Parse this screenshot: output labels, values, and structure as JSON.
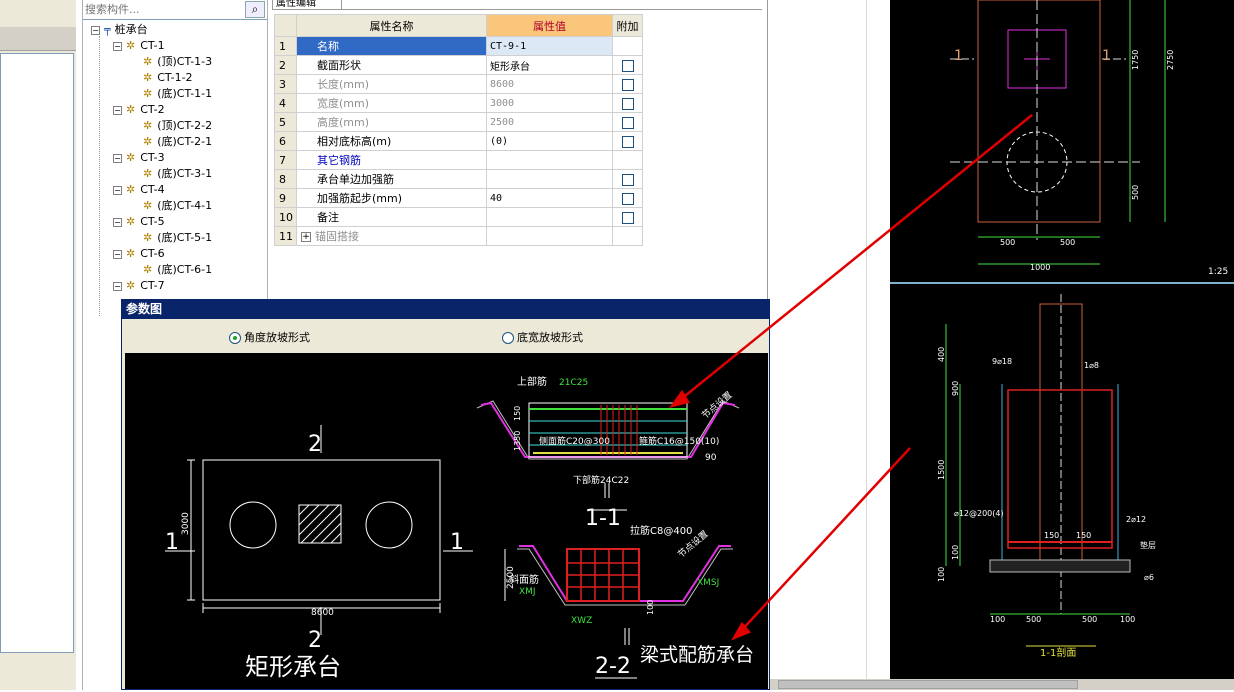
{
  "search": {
    "placeholder": "搜索构件..."
  },
  "tree": {
    "root": "桩承台",
    "nodes": [
      {
        "label": "CT-1",
        "level": 1
      },
      {
        "label": "(顶)CT-1-3",
        "level": 2
      },
      {
        "label": "CT-1-2",
        "level": 2
      },
      {
        "label": "(底)CT-1-1",
        "level": 2
      },
      {
        "label": "CT-2",
        "level": 1
      },
      {
        "label": "(顶)CT-2-2",
        "level": 2
      },
      {
        "label": "(底)CT-2-1",
        "level": 2
      },
      {
        "label": "CT-3",
        "level": 1
      },
      {
        "label": "(底)CT-3-1",
        "level": 2
      },
      {
        "label": "CT-4",
        "level": 1
      },
      {
        "label": "(底)CT-4-1",
        "level": 2
      },
      {
        "label": "CT-5",
        "level": 1
      },
      {
        "label": "(底)CT-5-1",
        "level": 2
      },
      {
        "label": "CT-6",
        "level": 1
      },
      {
        "label": "(底)CT-6-1",
        "level": 2
      },
      {
        "label": "CT-7",
        "level": 1
      }
    ]
  },
  "properties": {
    "tab": "属性编辑",
    "headers": {
      "name": "属性名称",
      "value": "属性值",
      "extra": "附加"
    },
    "rows": [
      {
        "num": "1",
        "name": "名称",
        "value": "CT-9-1",
        "style": "selected",
        "check": false
      },
      {
        "num": "2",
        "name": "截面形状",
        "value": "矩形承台",
        "style": "normal",
        "check": true
      },
      {
        "num": "3",
        "name": "长度(mm)",
        "value": "8600",
        "style": "gray",
        "check": true
      },
      {
        "num": "4",
        "name": "宽度(mm)",
        "value": "3000",
        "style": "gray",
        "check": true
      },
      {
        "num": "5",
        "name": "高度(mm)",
        "value": "2500",
        "style": "gray",
        "check": true
      },
      {
        "num": "6",
        "name": "相对底标高(m)",
        "value": "(0)",
        "style": "normal",
        "check": true
      },
      {
        "num": "7",
        "name": "其它钢筋",
        "value": "",
        "style": "blue",
        "check": false
      },
      {
        "num": "8",
        "name": "承台单边加强筋",
        "value": "",
        "style": "normal",
        "check": true
      },
      {
        "num": "9",
        "name": "加强筋起步(mm)",
        "value": "40",
        "style": "normal",
        "check": true
      },
      {
        "num": "10",
        "name": "备注",
        "value": "",
        "style": "normal",
        "check": true
      },
      {
        "num": "11",
        "name": "锚固搭接",
        "value": "",
        "style": "expand",
        "check": false
      }
    ]
  },
  "param_dialog": {
    "title": "参数图",
    "radio_angle": "角度放坡形式",
    "radio_width": "底宽放坡形式",
    "plan": {
      "label_top": "2",
      "label_bottom": "2",
      "label_left": "1",
      "label_right": "1",
      "dim_width": "8600",
      "dim_height": "3000",
      "caption": "矩形承台"
    },
    "section11": {
      "top_bar": "上部筋",
      "top_bar_val": "21C25",
      "side_bar": "侧面筋C20@300",
      "stirrup": "箍筋C16@150(10)",
      "bottom_bar": "下部筋24C22",
      "slope": "90",
      "dim1": "150",
      "dim2": "1350",
      "note": "节点设置",
      "caption": "1-1"
    },
    "section22": {
      "tie_bar": "拉筋C8@400",
      "slope_bar": "斜面筋",
      "xmj": "XMJ",
      "xmsj": "XMSJ",
      "xwz": "XWZ",
      "dim1": "2500",
      "dim2": "100",
      "note": "节点设置",
      "caption": "2-2"
    },
    "right_caption": "梁式配筋承台"
  },
  "cad": {
    "top": {
      "label_left": "1",
      "label_right": "1",
      "dim_a": "1750",
      "dim_b": "2750",
      "dim_c": "500",
      "dim_d": "500",
      "dim_e": "500",
      "dim_total": "1000",
      "scale": "1:25"
    },
    "bottom": {
      "d1": "400",
      "d2": "900",
      "d3": "1500",
      "d4": "100",
      "d5": "100",
      "b1": "100",
      "b2": "500",
      "b3": "500",
      "b4": "100",
      "inner1": "150",
      "inner2": "150",
      "note1": "9⌀18",
      "note2": "1⌀8",
      "note3": "2⌀12",
      "note4": "⌀12@200(4)",
      "note5": "垫层",
      "note6": "⌀6",
      "caption": "1-1剖面"
    }
  },
  "colors": {
    "arrow": "#e00000",
    "selection": "#316ac5",
    "dialog_title": "#0a246a",
    "value_header": "#f9c67c"
  }
}
